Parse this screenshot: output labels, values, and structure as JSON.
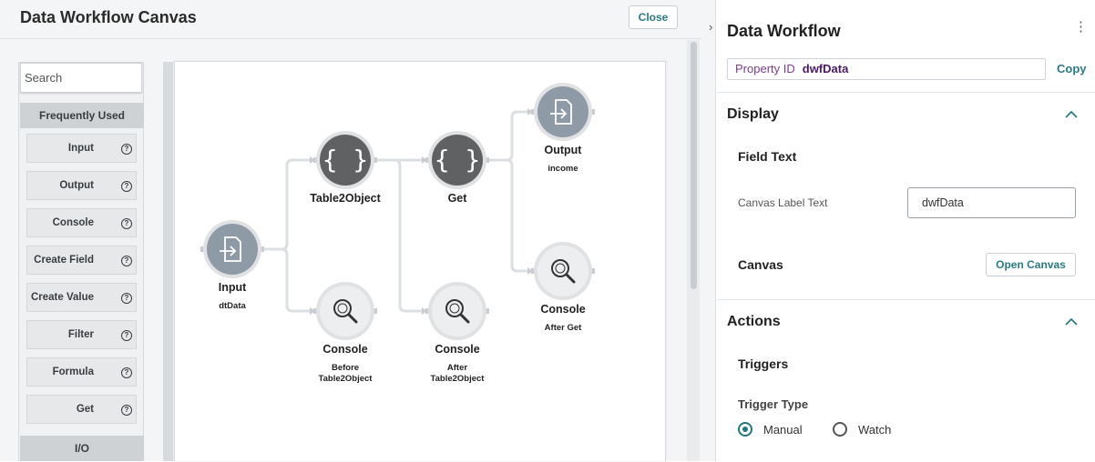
{
  "left": {
    "title": "Data Workflow Canvas",
    "close_label": "Close",
    "search": {
      "placeholder": "Search"
    },
    "sections": [
      {
        "label": "Frequently Used"
      },
      {
        "label": "I/O"
      }
    ],
    "palette_items": [
      {
        "label": "Input"
      },
      {
        "label": "Output"
      },
      {
        "label": "Console"
      },
      {
        "label": "Create Field"
      },
      {
        "label": "Create Value"
      },
      {
        "label": "Filter"
      },
      {
        "label": "Formula"
      },
      {
        "label": "Get"
      }
    ],
    "info_glyph": "?"
  },
  "workflow": {
    "nodes": [
      {
        "id": "input",
        "title": "Input",
        "subtitle": [
          "dtData"
        ],
        "icon": "file-import-icon"
      },
      {
        "id": "table2object",
        "title": "Table2Object",
        "subtitle": [],
        "icon": "curly-braces-icon"
      },
      {
        "id": "console-before",
        "title": "Console",
        "subtitle": [
          "Before",
          "Table2Object"
        ],
        "icon": "magnifier-icon"
      },
      {
        "id": "get",
        "title": "Get",
        "subtitle": [],
        "icon": "curly-braces-icon"
      },
      {
        "id": "console-after",
        "title": "Console",
        "subtitle": [
          "After",
          "Table2Object"
        ],
        "icon": "magnifier-icon"
      },
      {
        "id": "output",
        "title": "Output",
        "subtitle": [
          "income"
        ],
        "icon": "file-export-icon"
      },
      {
        "id": "console-afterget",
        "title": "Console",
        "subtitle": [
          "After Get"
        ],
        "icon": "magnifier-icon"
      }
    ],
    "edges": [
      [
        "input",
        "table2object"
      ],
      [
        "input",
        "console-before"
      ],
      [
        "table2object",
        "get"
      ],
      [
        "table2object",
        "console-after"
      ],
      [
        "get",
        "output"
      ],
      [
        "get",
        "console-afterget"
      ]
    ],
    "colors": {
      "io_node": "#8e9aa5",
      "func_node": "#5f6163",
      "console_node": "#eceeef",
      "edge": "#dcdfe2"
    }
  },
  "right": {
    "title": "Data Workflow",
    "menu_glyph": "⋮",
    "property_id_label": "Property ID",
    "property_id_value": "dwfData",
    "copy_label": "Copy",
    "display": {
      "heading": "Display",
      "field_text_heading": "Field Text",
      "canvas_label_text": "Canvas Label Text",
      "canvas_label_value": "dwfData",
      "canvas_heading": "Canvas",
      "open_canvas_label": "Open Canvas"
    },
    "actions": {
      "heading": "Actions",
      "triggers_heading": "Triggers",
      "trigger_type_label": "Trigger Type",
      "options": [
        {
          "label": "Manual",
          "selected": true
        },
        {
          "label": "Watch",
          "selected": false
        }
      ]
    },
    "accent_color": "#23787d"
  }
}
